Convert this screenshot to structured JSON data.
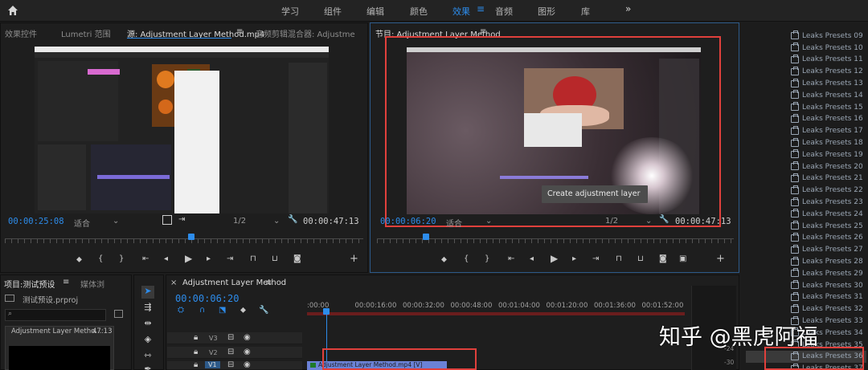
{
  "workspaces": [
    "学习",
    "组件",
    "编辑",
    "颜色",
    "效果",
    "音频",
    "图形",
    "库"
  ],
  "active_workspace": "效果",
  "accent": "#2d8ceb",
  "highlight": "#e0403c",
  "source_panel": {
    "tabs": [
      "效果控件",
      "Lumetri 范围",
      "源: Adjustment Layer Method.mp4",
      "音频剪辑混合器: Adjustme"
    ],
    "timecode": "00:00:25:08",
    "fit": "适合",
    "resolution": "1/2",
    "duration": "00:00:47:13"
  },
  "program_panel": {
    "title": "节目: Adjustment Layer Method",
    "timecode": "00:00:06:20",
    "fit": "适合",
    "resolution": "1/2",
    "duration": "00:00:47:13",
    "overlay_text": "Create adjustment layer"
  },
  "project_panel": {
    "tab": "项目:测试预设",
    "tab2": "媒体浏",
    "file": "测试预设.prproj",
    "clip_name": "Adjustment Layer Metho...",
    "clip_duration": "47:13"
  },
  "timeline": {
    "tab": "Adjustment Layer Method",
    "timecode": "00:00:06:20",
    "ticks": [
      ":00:00",
      "00:00:16:00",
      "00:00:32:00",
      "00:00:48:00",
      "00:01:04:00",
      "00:01:20:00",
      "00:01:36:00",
      "00:01:52:00"
    ],
    "tracks": [
      "V3",
      "V2",
      "V1"
    ],
    "clip": "Adjustment Layer Method.mp4 [V]",
    "meter": [
      "-24",
      "-30"
    ]
  },
  "presets": [
    "Leaks Presets 09",
    "Leaks Presets 10",
    "Leaks Presets 11",
    "Leaks Presets 12",
    "Leaks Presets 13",
    "Leaks Presets 14",
    "Leaks Presets 15",
    "Leaks Presets 16",
    "Leaks Presets 17",
    "Leaks Presets 18",
    "Leaks Presets 19",
    "Leaks Presets 20",
    "Leaks Presets 21",
    "Leaks Presets 22",
    "Leaks Presets 23",
    "Leaks Presets 24",
    "Leaks Presets 25",
    "Leaks Presets 26",
    "Leaks Presets 27",
    "Leaks Presets 28",
    "Leaks Presets 29",
    "Leaks Presets 30",
    "Leaks Presets 31",
    "Leaks Presets 32",
    "Leaks Presets 33",
    "Leaks Presets 34",
    "Leaks Presets 35",
    "Leaks Presets 36",
    "Leaks Presets 37"
  ],
  "watermark": "知乎 @黑虎阿福"
}
